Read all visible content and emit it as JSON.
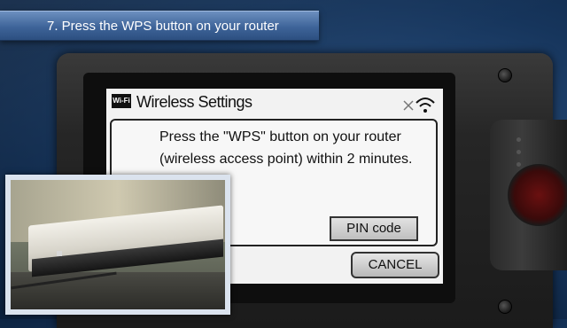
{
  "banner": {
    "step_title": "7. Press the WPS button on your router"
  },
  "dialog": {
    "badge": "Wi-Fi",
    "title": "Wireless Settings",
    "message": "Press the \"WPS\" button on your router (wireless access point) within 2 minutes.",
    "pin_button": "PIN code",
    "cancel_button": "CANCEL"
  },
  "icons": {
    "status": "signal-strength-icon",
    "no_signal": "x-icon",
    "screws": "screw-icon"
  },
  "colors": {
    "background": "#16355c",
    "banner": "#3e6499",
    "lcd": "#f2f2f2"
  }
}
